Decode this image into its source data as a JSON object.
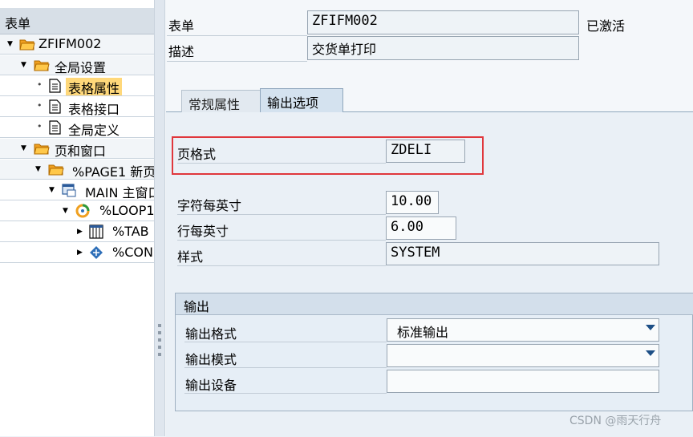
{
  "tree": {
    "header": "表单",
    "nodes": [
      {
        "label": "ZFIFM002"
      },
      {
        "label": "全局设置"
      },
      {
        "label": "表格属性"
      },
      {
        "label": "表格接口"
      },
      {
        "label": "全局定义"
      },
      {
        "label": "页和窗口"
      },
      {
        "label": "%PAGE1 新页"
      },
      {
        "label": "MAIN 主窗口"
      },
      {
        "label": "%LOOP1"
      },
      {
        "label": "%TAB"
      },
      {
        "label": "%CON"
      }
    ]
  },
  "header": {
    "form_label": "表单",
    "form_value": "ZFIFM002",
    "status": "已激活",
    "desc_label": "描述",
    "desc_value": "交货单打印"
  },
  "tabs": [
    {
      "label": "常规属性"
    },
    {
      "label": "输出选项",
      "active": true
    }
  ],
  "output_options": {
    "page_format_label": "页格式",
    "page_format_value": "ZDELI",
    "cpi_label": "字符每英寸",
    "cpi_value": "10.00",
    "lpi_label": "行每英寸",
    "lpi_value": "6.00",
    "style_label": "样式",
    "style_value": "SYSTEM"
  },
  "output_group": {
    "title": "输出",
    "format_label": "输出格式",
    "format_value": "标准输出",
    "mode_label": "输出模式",
    "mode_value": "",
    "device_label": "输出设备",
    "device_value": ""
  },
  "watermark": "CSDN @雨天行舟",
  "colors": {
    "highlight_border": "#e0373c",
    "selected_node": "#ffd87a",
    "folder": "#f0a020"
  }
}
